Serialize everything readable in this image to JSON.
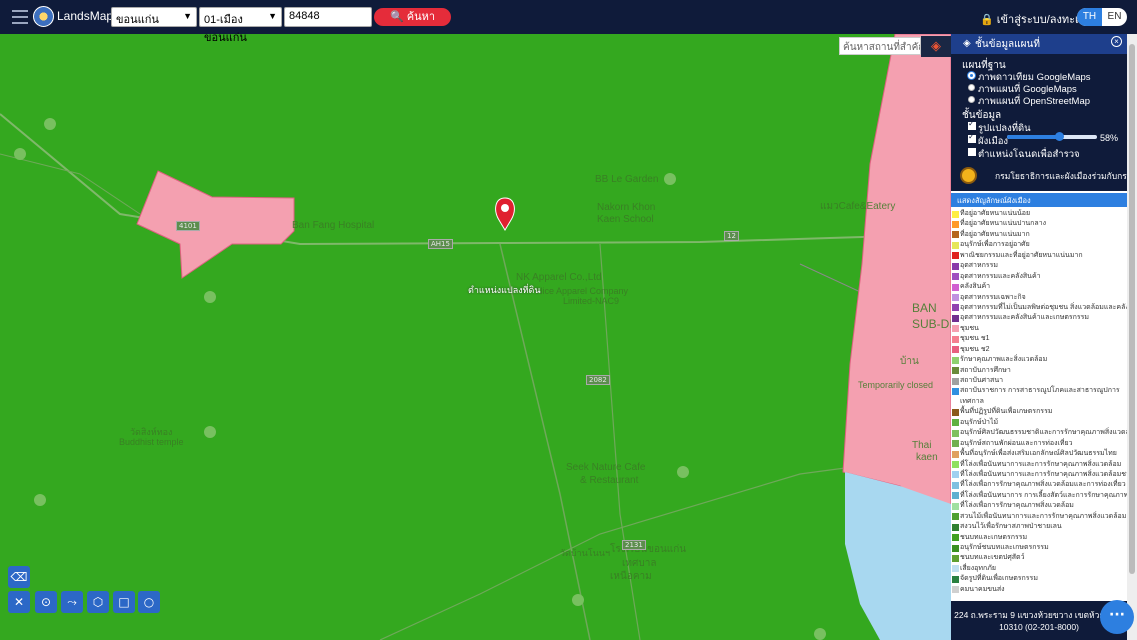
{
  "header": {
    "brand": "LandsMaps",
    "province": "ขอนแก่น",
    "district": "01-เมืองขอนแก่น",
    "parcel_no": "84848",
    "search_label": "ค้นหา",
    "login_label": "เข้าสู่ระบบ/ลงทะเบียน",
    "lang_th": "TH",
    "lang_en": "EN"
  },
  "map": {
    "place_search_placeholder": "ค้นหาสถานที่สำคัญ",
    "pin_label": "ตำแหน่งแปลงที่ดิน",
    "labels": [
      "BB Le Garden",
      "Nakorn Khon",
      "Kaen School",
      "Ban Fang Hospital",
      "NK Apparel Co.,Ltd",
      "Nice Apparel Company",
      "Limited-NAC9",
      "Seek Nature Cafe",
      "& Restaurant",
      "BAN",
      "SUB-DIS",
      "บ้าน",
      "Temporarily closed",
      "Thai",
      "kaen",
      "Buddhist temple",
      "วัดสิงห์ทอง",
      "โรงเรียนขอนแก่น",
      "เทศบาล",
      "เหนือคาม",
      "วัดบ้านโนนฯ",
      "แมวCafe&Eatery"
    ],
    "road_numbers": [
      "4101",
      "12",
      "2082",
      "2131"
    ],
    "road_label": "AH15",
    "zoning_color": "#f4a0b0",
    "agri_color": "#34a81f",
    "water_color": "#a8d8f0"
  },
  "panel": {
    "title": "ชั้นข้อมูลแผนที่",
    "basemap_heading": "แผนที่ฐาน",
    "basemaps": [
      {
        "label": "ภาพดาวเทียม GoogleMaps",
        "selected": true
      },
      {
        "label": "ภาพแผนที่ GoogleMaps",
        "selected": false
      },
      {
        "label": "ภาพแผนที่ OpenStreetMap",
        "selected": false
      }
    ],
    "data_heading": "ชั้นข้อมูล",
    "layers": [
      {
        "label": "รูปแปลงที่ดิน",
        "checked": true
      },
      {
        "label": "ผังเมือง",
        "checked": true
      },
      {
        "label": "ตำแหน่งโฉนดเพื่อสำรวจ",
        "checked": false
      }
    ],
    "opacity_percent": 58,
    "opacity_label": "58%",
    "department": "กรมโยธาธิการและผังเมืองร่วมกับกรมที่ดิน",
    "legend_heading": "แสดงสัญลักษณ์ผังเมือง",
    "legend": [
      {
        "label": "ที่อยู่อาศัยหนาแน่นน้อย",
        "color": "#ffee44"
      },
      {
        "label": "ที่อยู่อาศัยหนาแน่นปานกลาง",
        "color": "#ff9a2a"
      },
      {
        "label": "ที่อยู่อาศัยหนาแน่นมาก",
        "color": "#b5651d"
      },
      {
        "label": "อนุรักษ์เพื่อการอยู่อาศัย",
        "color": "#e6e65a"
      },
      {
        "label": "พาณิชยกรรมและที่อยู่อาศัยหนาแน่นมาก",
        "color": "#e02020"
      },
      {
        "label": "อุตสาหกรรม",
        "color": "#8a3aaa"
      },
      {
        "label": "อุตสาหกรรมและคลังสินค้า",
        "color": "#a050c0"
      },
      {
        "label": "คลังสินค้า",
        "color": "#d060d0"
      },
      {
        "label": "อุตสาหกรรมเฉพาะกิจ",
        "color": "#c090e0"
      },
      {
        "label": "อุตสาหกรรมที่ไม่เป็นมลพิษต่อชุมชน สิ่งแวดล้อมและคลังสินค้า",
        "color": "#9040b0"
      },
      {
        "label": "อุตสาหกรรมและคลังสินค้าและเกษตรกรรม",
        "color": "#703090"
      },
      {
        "label": "ชุมชน",
        "color": "#f4a0b0"
      },
      {
        "label": "ชุมชน ช1",
        "color": "#f48090"
      },
      {
        "label": "ชุมชน ช2",
        "color": "#e86080"
      },
      {
        "label": "รักษาคุณภาพและสิ่งแวดล้อม",
        "color": "#90d070"
      },
      {
        "label": "สถาบันการศึกษา",
        "color": "#6a8a3a"
      },
      {
        "label": "สถาบันศาสนา",
        "color": "#a0a0a0"
      },
      {
        "label": "สถาบันราชการ การสาธารณูปโภคและสาธารณูปการ",
        "color": "#3090e0"
      },
      {
        "label": "เทศกาล",
        "color": "#ffffff"
      },
      {
        "label": "พื้นที่ปฏิรูปที่ดินเพื่อเกษตรกรรม",
        "color": "#8a5a1a"
      },
      {
        "label": "อนุรักษ์ป่าไม้",
        "color": "#60b040"
      },
      {
        "label": "อนุรักษ์ศิลปวัฒนธรรมชาติและการรักษาคุณภาพสิ่งแวดล้อม",
        "color": "#80c060"
      },
      {
        "label": "อนุรักษ์สถานพักผ่อนและการท่องเที่ยว",
        "color": "#70b050"
      },
      {
        "label": "พื้นที่อนุรักษ์เพื่อส่งเสริมเอกลักษณ์ศิลปวัฒนธรรมไทย",
        "color": "#e0a060"
      },
      {
        "label": "ที่โล่งเพื่อนันทนาการและการรักษาคุณภาพสิ่งแวดล้อม",
        "color": "#90e060"
      },
      {
        "label": "ที่โล่งเพื่อนันทนาการและการรักษาคุณภาพสิ่งแวดล้อมชายฝั่ง",
        "color": "#a0d0f0"
      },
      {
        "label": "ที่โล่งเพื่อการรักษาคุณภาพสิ่งแวดล้อมและการท่องเที่ยว",
        "color": "#80c0e0"
      },
      {
        "label": "ที่โล่งเพื่อนันทนาการ การเลี้ยงสัตว์และการรักษาคุณภาพสิ่ง",
        "color": "#60b0d0"
      },
      {
        "label": "ที่โล่งเพื่อการรักษาคุณภาพสิ่งแวดล้อม",
        "color": "#a0e0a0"
      },
      {
        "label": "สวนไม้เพื่อนันทนาการและการรักษาคุณภาพสิ่งแวดล้อม",
        "color": "#50a030"
      },
      {
        "label": "สงวนไว้เพื่อรักษาสภาพป่าชายเลน",
        "color": "#308030"
      },
      {
        "label": "ชนบทและเกษตรกรรม",
        "color": "#40a020"
      },
      {
        "label": "อนุรักษ์ชนบทและเกษตรกรรม",
        "color": "#3a9020"
      },
      {
        "label": "ชนบทและเขตปศุสัตว์",
        "color": "#60a030"
      },
      {
        "label": "เสี่ยงอุทกภัย",
        "color": "#c0e0f0"
      },
      {
        "label": "จัดรูปที่ดินเพื่อเกษตรกรรม",
        "color": "#2a8040"
      },
      {
        "label": "คมนาคมขนส่ง",
        "color": "#d0d0d0"
      }
    ],
    "footer_line1": "224 ถ.พระราม 9 แขวงห้วยขวาง เขตห้วยขวาง",
    "footer_line2": "10310 (02-201-8000)"
  },
  "tools": [
    "eraser-icon",
    "ruler-icon",
    "marker-icon",
    "polyline-icon",
    "polygon-icon",
    "rectangle-icon",
    "circle-icon"
  ]
}
